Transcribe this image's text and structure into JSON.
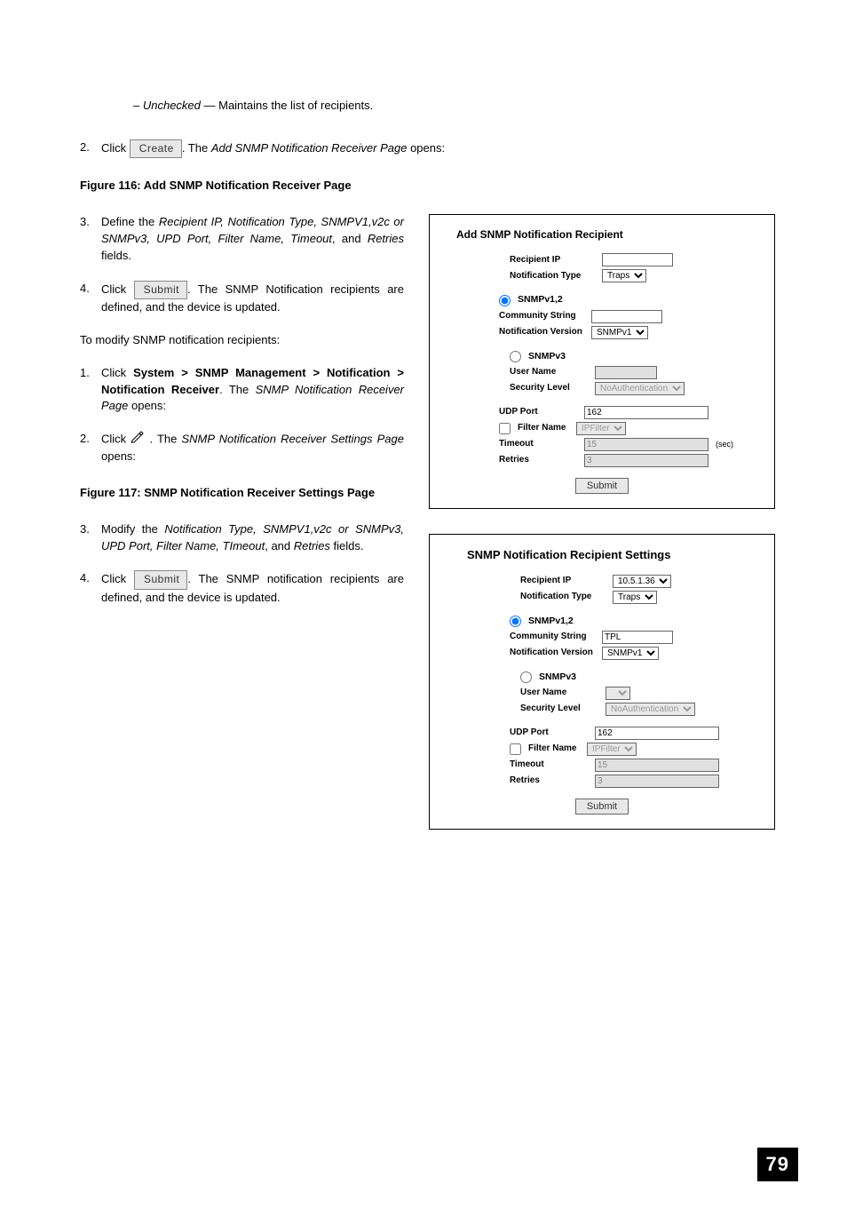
{
  "indent_line_prefix": "– ",
  "indent_line_em": "Unchecked",
  "indent_line_rest": " — Maintains the list of recipients.",
  "list1": {
    "num2": "2.",
    "step2_a": "Click ",
    "create_btn": "Create",
    "step2_b": ". The ",
    "step2_em": "Add SNMP Notification Receiver Page",
    "step2_c": " opens:"
  },
  "fig116": "Figure 116: Add SNMP Notification Receiver Page",
  "list2": {
    "num3": "3.",
    "step3_a": "Define the ",
    "step3_em": "Recipient IP, Notification Type, SNMPV1,v2c or SNMPv3, UPD Port, Filter Name, Timeout",
    "step3_b": ", and ",
    "step3_em2": "Retries",
    "step3_c": " fields.",
    "num4": "4.",
    "step4_a": "Click ",
    "submit_btn": "Submit",
    "step4_b": ". The SNMP Notification recipients are defined, and the device is updated."
  },
  "para_modify": "To modify SNMP notification recipients:",
  "list3": {
    "num1": "1.",
    "step1_a": "Click ",
    "step1_b": "System > SNMP Management > Notification > Notification Receiver",
    "step1_c": ". The ",
    "step1_em": "SNMP Notification Receiver Page",
    "step1_d": " opens:",
    "num2": "2.",
    "step2_a": "Click ",
    "step2_b": " . The ",
    "step2_em": "SNMP Notification Receiver Settings Page",
    "step2_c": " opens:"
  },
  "fig117": "Figure 117: SNMP Notification Receiver Settings Page",
  "list4": {
    "num3": "3.",
    "step3_a": "Modify the ",
    "step3_em": "Notification Type, SNMPV1,v2c or SNMPv3, UPD Port, Filter Name, TImeout",
    "step3_b": ", and ",
    "step3_em2": "Retries",
    "step3_c": " fields.",
    "num4": "4.",
    "step4_a": "Click ",
    "submit_btn": "Submit",
    "step4_b": ". The SNMP notification recipients are defined, and the device is updated."
  },
  "panel1": {
    "title": "Add SNMP Notification Recipient",
    "recipient_ip": "Recipient IP",
    "recipient_ip_val": "",
    "notif_type": "Notification Type",
    "notif_type_val": "Traps",
    "snmpv12": "SNMPv1,2",
    "community": "Community String",
    "community_val": "",
    "notif_ver": "Notification Version",
    "notif_ver_val": "SNMPv1",
    "snmpv3": "SNMPv3",
    "username": "User Name",
    "username_val": "",
    "sec_level": "Security Level",
    "sec_level_val": "NoAuthentication",
    "udp": "UDP Port",
    "udp_val": "162",
    "filter": "Filter Name",
    "filter_val": "IPFilter",
    "timeout": "Timeout",
    "timeout_val": "15",
    "sec": "(sec)",
    "retries": "Retries",
    "retries_val": "3",
    "submit": "Submit"
  },
  "panel2": {
    "title": "SNMP Notification Recipient Settings",
    "recipient_ip": "Recipient IP",
    "recipient_ip_val": "10.5.1.36",
    "notif_type": "Notification Type",
    "notif_type_val": "Traps",
    "snmpv12": "SNMPv1,2",
    "community": "Community String",
    "community_val": "TPL",
    "notif_ver": "Notification Version",
    "notif_ver_val": "SNMPv1",
    "snmpv3": "SNMPv3",
    "username": "User Name",
    "username_val": "",
    "sec_level": "Security Level",
    "sec_level_val": "NoAuthentication",
    "udp": "UDP Port",
    "udp_val": "162",
    "filter": "Filter Name",
    "filter_val": "IPFilter",
    "timeout": "Timeout",
    "timeout_val": "15",
    "retries": "Retries",
    "retries_val": "3",
    "submit": "Submit"
  },
  "page_number": "79"
}
